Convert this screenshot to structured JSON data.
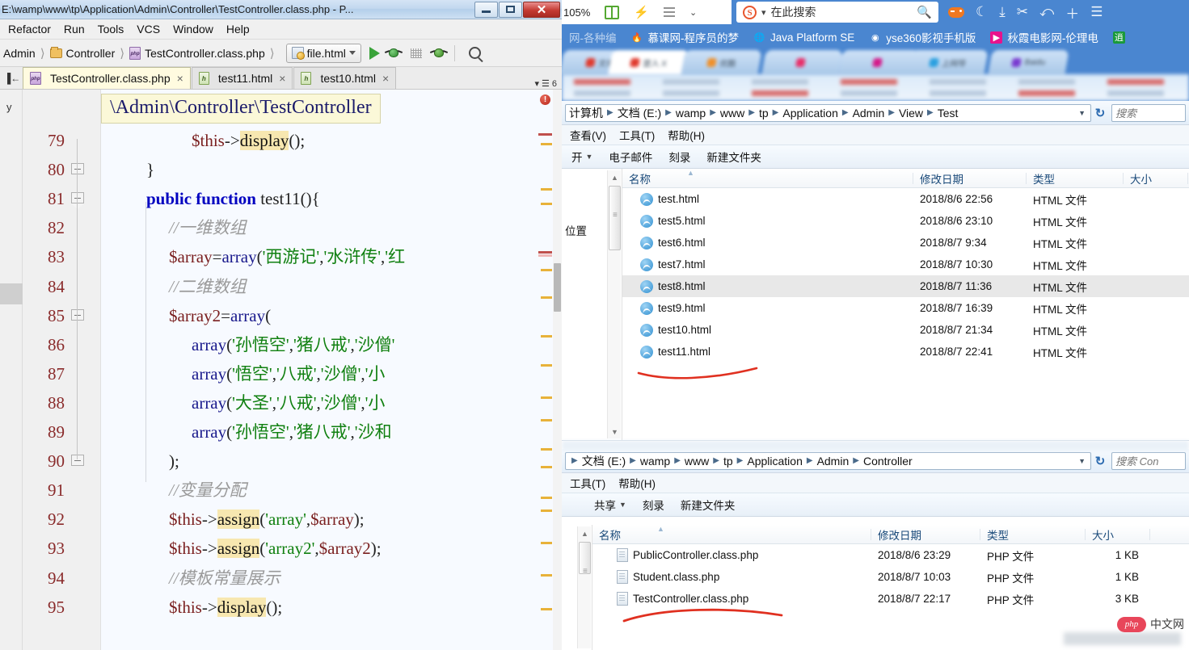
{
  "ide": {
    "title": "E:\\wamp\\www\\tp\\Application\\Admin\\Controller\\TestController.class.php - P...",
    "window_buttons": {
      "minimize": "minimize-button",
      "maximize": "maximize-button",
      "close": "✕"
    },
    "menus": [
      "Refactor",
      "Run",
      "Tools",
      "VCS",
      "Window",
      "Help"
    ],
    "breadcrumb": [
      "Admin",
      "Controller",
      "TestController.class.php"
    ],
    "run_config": "file.html",
    "tabs": [
      {
        "label": "TestController.class.php",
        "icon": "php-file-icon",
        "active": true
      },
      {
        "label": "test11.html",
        "icon": "html-file-icon",
        "active": false
      },
      {
        "label": "test10.html",
        "icon": "html-file-icon",
        "active": false
      }
    ],
    "tabs_counter": "6",
    "left_strip_label": "y",
    "hint": "\\Admin\\Controller\\TestController",
    "error_badge": "!",
    "line_numbers": [
      79,
      80,
      81,
      82,
      83,
      84,
      85,
      86,
      87,
      88,
      89,
      90,
      91,
      92,
      93,
      94,
      95
    ],
    "code": [
      {
        "n": 79,
        "indent": 4,
        "tokens": [
          {
            "t": "$this",
            "c": "var"
          },
          {
            "t": "->",
            "c": "pun"
          },
          {
            "t": "display",
            "c": "hl"
          },
          {
            "t": "();",
            "c": "pun"
          }
        ]
      },
      {
        "n": 80,
        "indent": 2,
        "tokens": [
          {
            "t": "}",
            "c": "pun"
          }
        ]
      },
      {
        "n": 81,
        "indent": 2,
        "tokens": [
          {
            "t": "public function ",
            "c": "kw"
          },
          {
            "t": "test11",
            "c": "plain"
          },
          {
            "t": "(){",
            "c": "pun"
          }
        ]
      },
      {
        "n": 82,
        "indent": 3,
        "tokens": [
          {
            "t": "//一维数组",
            "c": "cmt"
          }
        ]
      },
      {
        "n": 83,
        "indent": 3,
        "tokens": [
          {
            "t": "$array",
            "c": "var"
          },
          {
            "t": "=",
            "c": "pun"
          },
          {
            "t": "array",
            "c": "fn"
          },
          {
            "t": "(",
            "c": "pun"
          },
          {
            "t": "'西游记'",
            "c": "str"
          },
          {
            "t": ",",
            "c": "pun"
          },
          {
            "t": "'水浒传'",
            "c": "str"
          },
          {
            "t": ",",
            "c": "pun"
          },
          {
            "t": "'红",
            "c": "str"
          }
        ]
      },
      {
        "n": 84,
        "indent": 3,
        "tokens": [
          {
            "t": "//二维数组",
            "c": "cmt"
          }
        ]
      },
      {
        "n": 85,
        "indent": 3,
        "tokens": [
          {
            "t": "$array2",
            "c": "var"
          },
          {
            "t": "=",
            "c": "pun"
          },
          {
            "t": "array",
            "c": "fn"
          },
          {
            "t": "(",
            "c": "pun"
          }
        ]
      },
      {
        "n": 86,
        "indent": 4,
        "tokens": [
          {
            "t": "array",
            "c": "fn"
          },
          {
            "t": "(",
            "c": "pun"
          },
          {
            "t": "'孙悟空'",
            "c": "str"
          },
          {
            "t": ",",
            "c": "pun"
          },
          {
            "t": "'猪八戒'",
            "c": "str"
          },
          {
            "t": ",",
            "c": "pun"
          },
          {
            "t": "'沙僧'",
            "c": "str"
          }
        ]
      },
      {
        "n": 87,
        "indent": 4,
        "tokens": [
          {
            "t": "array",
            "c": "fn"
          },
          {
            "t": "(",
            "c": "pun"
          },
          {
            "t": "'悟空'",
            "c": "str"
          },
          {
            "t": ",",
            "c": "pun"
          },
          {
            "t": "'八戒'",
            "c": "str"
          },
          {
            "t": ",",
            "c": "pun"
          },
          {
            "t": "'沙僧'",
            "c": "str"
          },
          {
            "t": ",",
            "c": "pun"
          },
          {
            "t": "'小",
            "c": "str"
          }
        ]
      },
      {
        "n": 88,
        "indent": 4,
        "tokens": [
          {
            "t": "array",
            "c": "fn"
          },
          {
            "t": "(",
            "c": "pun"
          },
          {
            "t": "'大圣'",
            "c": "str"
          },
          {
            "t": ",",
            "c": "pun"
          },
          {
            "t": "'八戒'",
            "c": "str"
          },
          {
            "t": ",",
            "c": "pun"
          },
          {
            "t": "'沙僧'",
            "c": "str"
          },
          {
            "t": ",",
            "c": "pun"
          },
          {
            "t": "'小",
            "c": "str"
          }
        ]
      },
      {
        "n": 89,
        "indent": 4,
        "tokens": [
          {
            "t": "array",
            "c": "fn"
          },
          {
            "t": "(",
            "c": "pun"
          },
          {
            "t": "'孙悟空'",
            "c": "str"
          },
          {
            "t": ",",
            "c": "pun"
          },
          {
            "t": "'猪八戒'",
            "c": "str"
          },
          {
            "t": ",",
            "c": "pun"
          },
          {
            "t": "'沙和",
            "c": "str"
          }
        ]
      },
      {
        "n": 90,
        "indent": 3,
        "tokens": [
          {
            "t": ");",
            "c": "pun"
          }
        ]
      },
      {
        "n": 91,
        "indent": 3,
        "tokens": [
          {
            "t": "//变量分配",
            "c": "cmt"
          }
        ]
      },
      {
        "n": 92,
        "indent": 3,
        "tokens": [
          {
            "t": "$this",
            "c": "var"
          },
          {
            "t": "->",
            "c": "pun"
          },
          {
            "t": "assign",
            "c": "hl"
          },
          {
            "t": "(",
            "c": "pun"
          },
          {
            "t": "'array'",
            "c": "str"
          },
          {
            "t": ",",
            "c": "pun"
          },
          {
            "t": "$array",
            "c": "var"
          },
          {
            "t": ");",
            "c": "pun"
          }
        ]
      },
      {
        "n": 93,
        "indent": 3,
        "tokens": [
          {
            "t": "$this",
            "c": "var"
          },
          {
            "t": "->",
            "c": "pun"
          },
          {
            "t": "assign",
            "c": "hl"
          },
          {
            "t": "(",
            "c": "pun"
          },
          {
            "t": "'array2'",
            "c": "str"
          },
          {
            "t": ",",
            "c": "pun"
          },
          {
            "t": "$array2",
            "c": "var"
          },
          {
            "t": ");",
            "c": "pun"
          }
        ]
      },
      {
        "n": 94,
        "indent": 3,
        "tokens": [
          {
            "t": "//模板常量展示",
            "c": "cmt"
          }
        ]
      },
      {
        "n": 95,
        "indent": 3,
        "tokens": [
          {
            "t": "$this",
            "c": "var"
          },
          {
            "t": "->",
            "c": "pun"
          },
          {
            "t": "display",
            "c": "hl"
          },
          {
            "t": "();",
            "c": "pun"
          }
        ]
      }
    ]
  },
  "browser": {
    "zoom": "105%",
    "search_placeholder": "在此搜索",
    "search_engine": "S",
    "icons": [
      "bookmark-icon",
      "lightning-icon",
      "menu-dots-icon",
      "chevron-down-icon",
      "gamepad-icon",
      "night-mode-icon",
      "download-icon",
      "scissors-icon",
      "history-icon",
      "new-tab-icon",
      "hamburger-menu-icon"
    ],
    "bookmarks": [
      {
        "label": "网-各种编",
        "icon": ""
      },
      {
        "label": "慕课网-程序员的梦",
        "icon": "🔥"
      },
      {
        "label": "Java Platform SE",
        "icon": "🌐"
      },
      {
        "label": "yse360影视手机版",
        "icon": "◉"
      },
      {
        "label": "秋霞电影网-伦理电",
        "icon": "▶"
      },
      {
        "label": "逍",
        "icon": "逍"
      }
    ],
    "tabs": [
      {
        "label": "文章"
      },
      {
        "label": "登入 X"
      },
      {
        "label": "优酷"
      },
      {
        "label": ""
      },
      {
        "label": ""
      },
      {
        "label": "上网导"
      },
      {
        "label": "Baidu"
      }
    ]
  },
  "explorer1": {
    "path": [
      "计算机",
      "文档 (E:)",
      "wamp",
      "www",
      "tp",
      "Application",
      "Admin",
      "View",
      "Test"
    ],
    "search_placeholder": "搜索",
    "menus": [
      "查看(V)",
      "工具(T)",
      "帮助(H)"
    ],
    "toolbar": [
      "开",
      "电子邮件",
      "刻录",
      "新建文件夹"
    ],
    "nav_label": "位置",
    "columns": [
      "名称",
      "修改日期",
      "类型",
      "大小"
    ],
    "files": [
      {
        "name": "test.html",
        "date": "2018/8/6 22:56",
        "type": "HTML 文件",
        "size": "",
        "selected": false
      },
      {
        "name": "test5.html",
        "date": "2018/8/6 23:10",
        "type": "HTML 文件",
        "size": "",
        "selected": false
      },
      {
        "name": "test6.html",
        "date": "2018/8/7 9:34",
        "type": "HTML 文件",
        "size": "",
        "selected": false
      },
      {
        "name": "test7.html",
        "date": "2018/8/7 10:30",
        "type": "HTML 文件",
        "size": "",
        "selected": false
      },
      {
        "name": "test8.html",
        "date": "2018/8/7 11:36",
        "type": "HTML 文件",
        "size": "",
        "selected": true
      },
      {
        "name": "test9.html",
        "date": "2018/8/7 16:39",
        "type": "HTML 文件",
        "size": "",
        "selected": false
      },
      {
        "name": "test10.html",
        "date": "2018/8/7 21:34",
        "type": "HTML 文件",
        "size": "",
        "selected": false
      },
      {
        "name": "test11.html",
        "date": "2018/8/7 22:41",
        "type": "HTML 文件",
        "size": "",
        "selected": false
      }
    ],
    "annotation": "red-underline-test11"
  },
  "explorer2": {
    "path": [
      "文档 (E:)",
      "wamp",
      "www",
      "tp",
      "Application",
      "Admin",
      "Controller"
    ],
    "search_placeholder": "搜索 Con",
    "menus": [
      "工具(T)",
      "帮助(H)"
    ],
    "toolbar": [
      "共享",
      "刻录",
      "新建文件夹"
    ],
    "columns": [
      "名称",
      "修改日期",
      "类型",
      "大小"
    ],
    "files": [
      {
        "name": "PublicController.class.php",
        "date": "2018/8/6 23:29",
        "type": "PHP 文件",
        "size": "1 KB"
      },
      {
        "name": "Student.class.php",
        "date": "2018/8/7 10:03",
        "type": "PHP 文件",
        "size": "1 KB"
      },
      {
        "name": "TestController.class.php",
        "date": "2018/8/7 22:17",
        "type": "PHP 文件",
        "size": "3 KB"
      }
    ],
    "annotation": "red-underline-testcontroller"
  },
  "watermark": {
    "badge": "php",
    "text": "中文网"
  },
  "colors": {
    "accent_blue": "#4a86d0",
    "annotation_red": "#e03020",
    "string_green": "#108010",
    "keyword_blue": "#0000c0",
    "linenum_red": "#8a2b2b",
    "highlight_yellow": "#f7e7b0"
  }
}
